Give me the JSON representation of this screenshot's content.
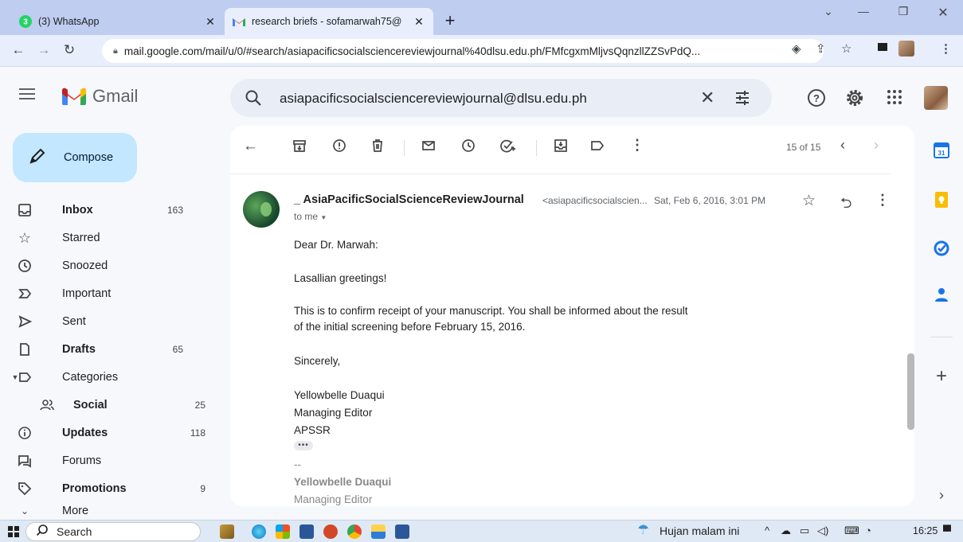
{
  "browser": {
    "tabs": [
      {
        "title": "(3) WhatsApp",
        "favicon_badge": "3"
      },
      {
        "title": "research briefs - sofamarwah75@",
        "favicon_letter": "M"
      }
    ],
    "url": "mail.google.com/mail/u/0/#search/asiapacificsocialsciencereviewjournal%40dlsu.edu.ph/FMfcgxmMljvsQqnzllZZSvPdQ..."
  },
  "gmail": {
    "app_name": "Gmail",
    "search_query": "asiapacificsocialsciencereviewjournal@dlsu.edu.ph",
    "compose_label": "Compose",
    "nav": [
      {
        "label": "Inbox",
        "count": "163",
        "bold": true,
        "icon": "inbox-icon"
      },
      {
        "label": "Starred",
        "count": "",
        "icon": "star-icon"
      },
      {
        "label": "Snoozed",
        "count": "",
        "icon": "clock-icon"
      },
      {
        "label": "Important",
        "count": "",
        "icon": "important-icon"
      },
      {
        "label": "Sent",
        "count": "",
        "icon": "send-icon"
      },
      {
        "label": "Drafts",
        "count": "65",
        "bold": true,
        "icon": "draft-icon"
      },
      {
        "label": "Categories",
        "count": "",
        "icon": "label-icon"
      },
      {
        "label": "Social",
        "count": "25",
        "bold": true,
        "icon": "people-icon"
      },
      {
        "label": "Updates",
        "count": "118",
        "bold": true,
        "icon": "info-icon"
      },
      {
        "label": "Forums",
        "count": "",
        "icon": "forum-icon"
      },
      {
        "label": "Promotions",
        "count": "9",
        "bold": true,
        "icon": "tag-icon"
      },
      {
        "label": "More",
        "count": "",
        "icon": "chevron-down-icon"
      }
    ],
    "pager": "15 of 15",
    "message": {
      "sender_name": "_ AsiaPacificSocialScienceReviewJournal",
      "sender_email": "<asiapacificsocialscien...",
      "date": "Sat, Feb 6, 2016, 3:01 PM",
      "to": "to me",
      "body": [
        "Dear Dr. Marwah:",
        "Lasallian greetings!",
        "This is to confirm receipt of your manuscript. You shall be informed about the result",
        "of the initial screening before February 15, 2016.",
        "Sincerely,",
        "Yellowbelle Duaqui",
        "Managing Editor",
        "APSSR"
      ],
      "ellipsis": "•••",
      "sig_dashes": "--",
      "sig_name": "Yellowbelle Duaqui",
      "sig_role": "Managing Editor"
    }
  },
  "taskbar": {
    "search_label": "Search",
    "weather": "Hujan malam ini",
    "time": "16:25"
  }
}
